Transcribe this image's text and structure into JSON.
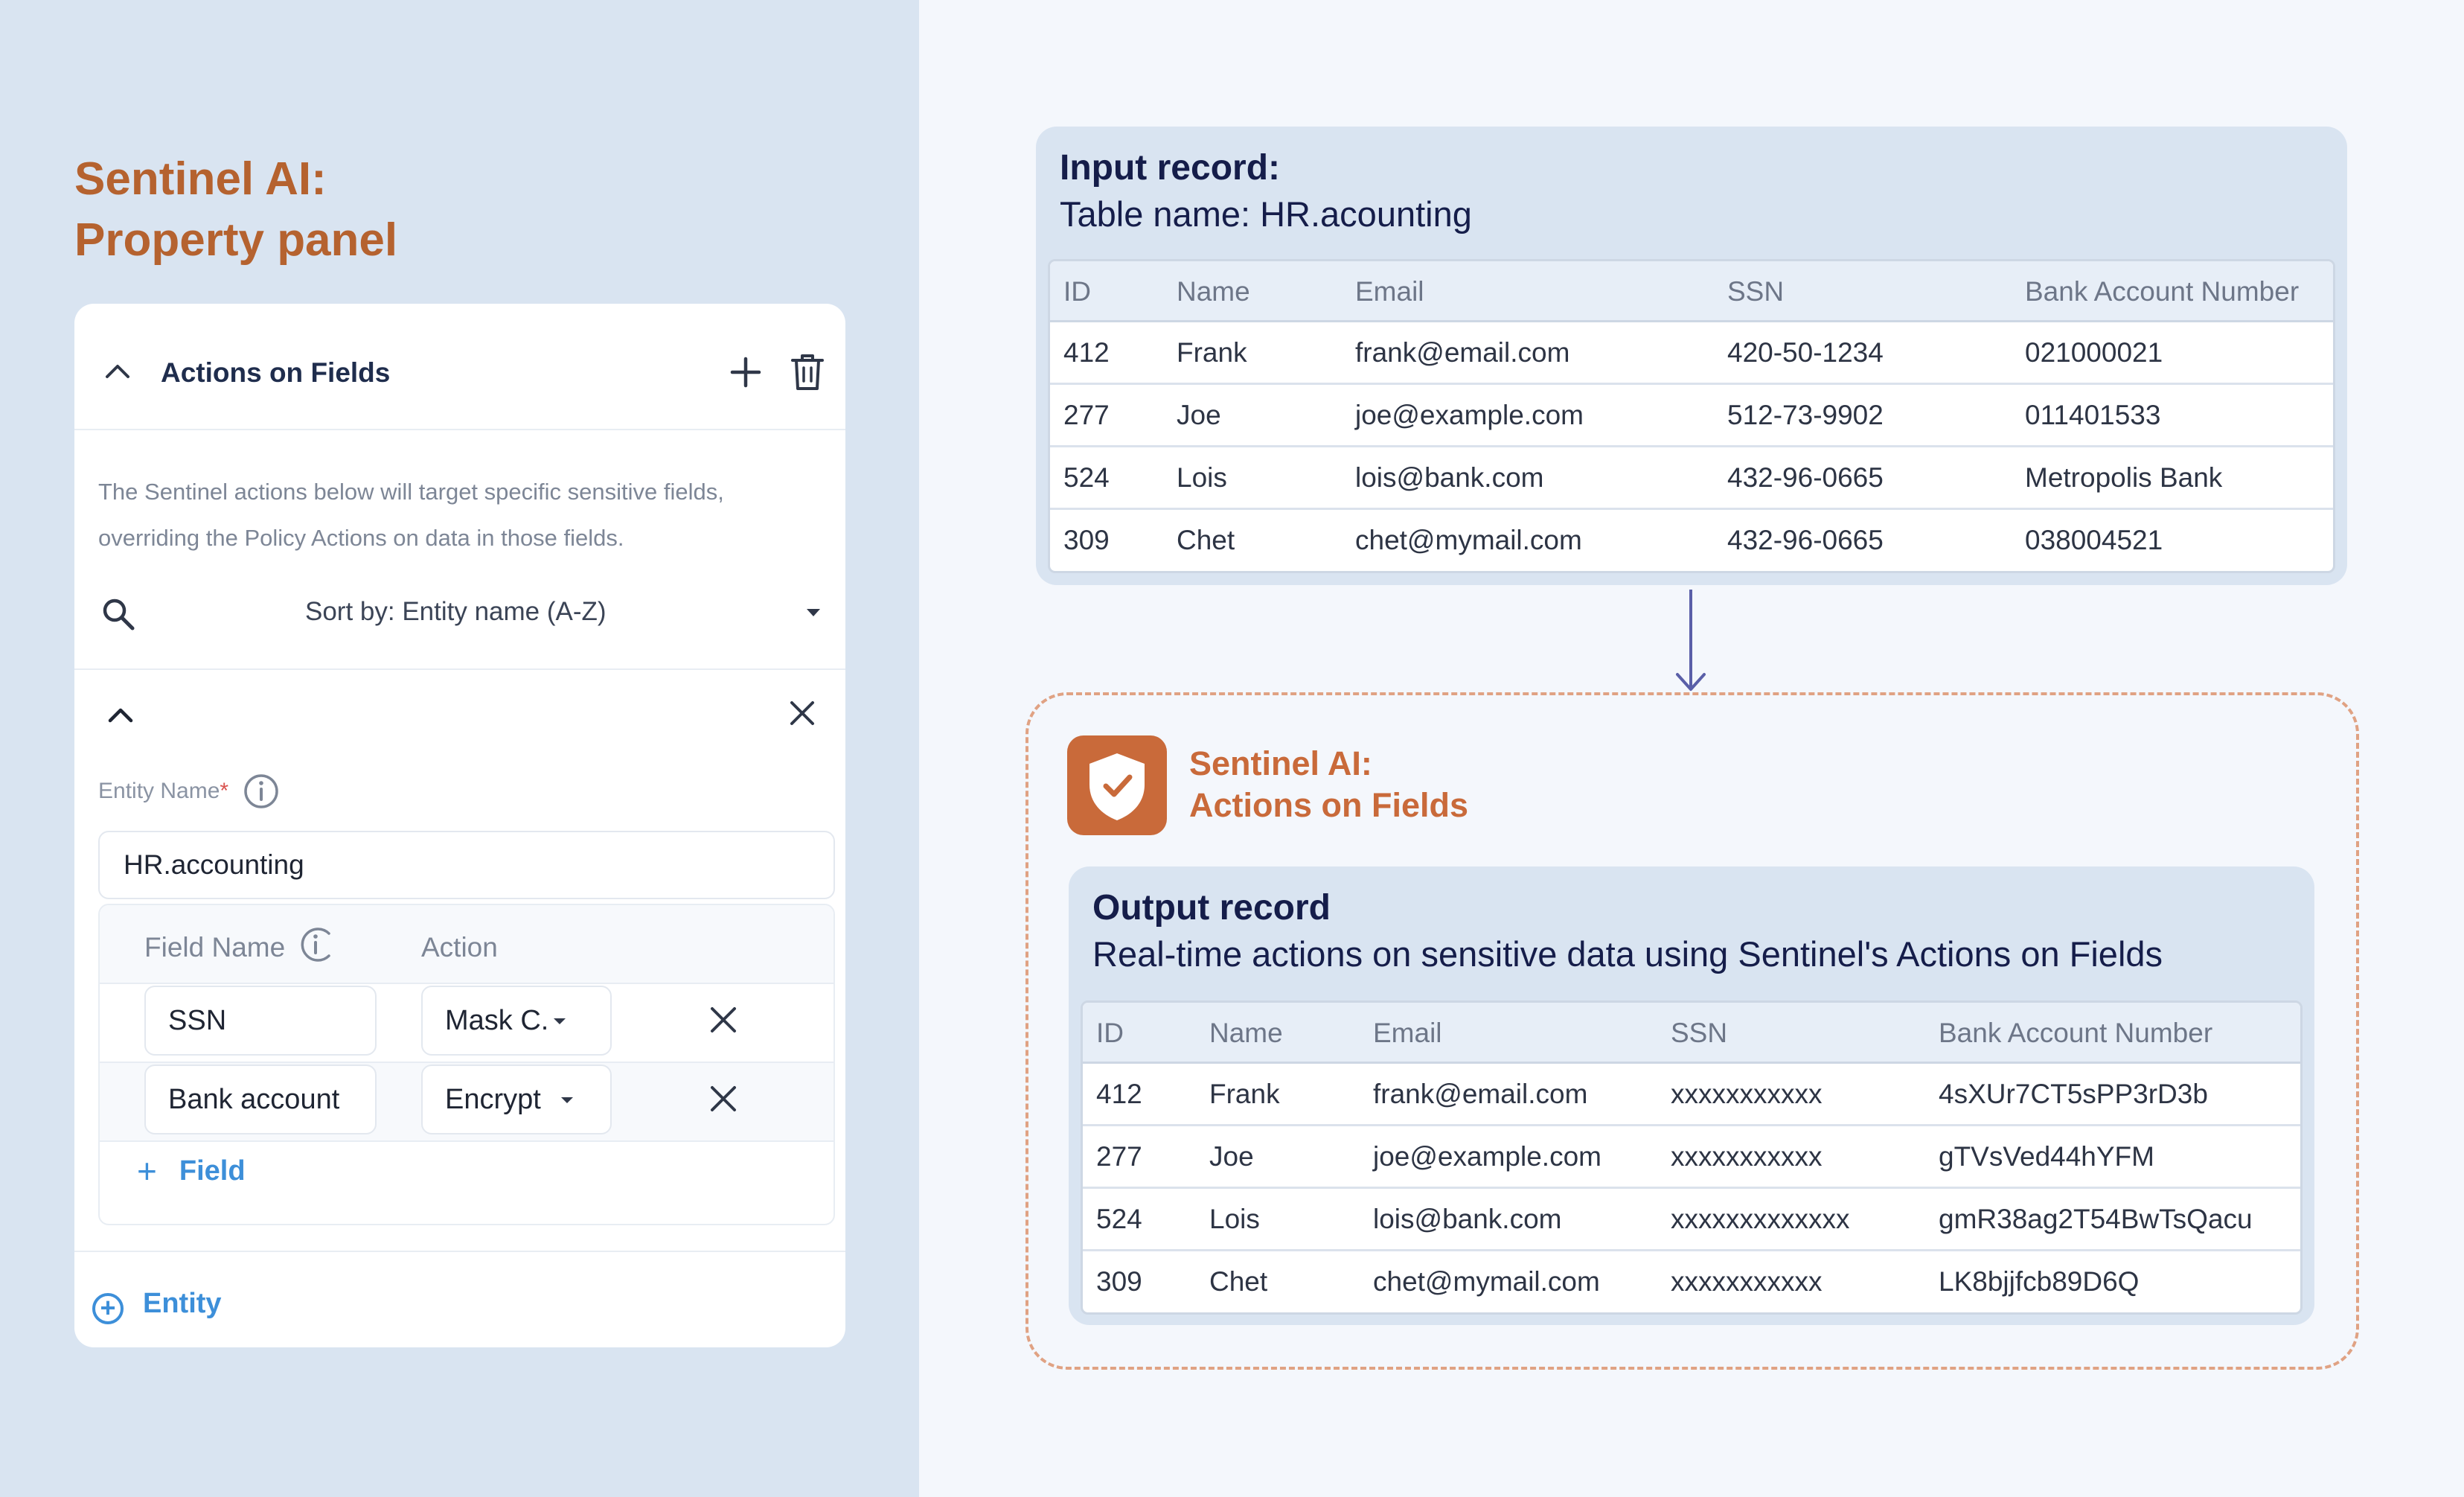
{
  "heading": {
    "line1": "Sentinel AI:",
    "line2": "Property panel"
  },
  "panel": {
    "title": "Actions on Fields",
    "description_line1": "The Sentinel actions below will target specific sensitive fields,",
    "description_line2": "overriding the Policy Actions on data in those fields.",
    "sort_label": "Sort by: Entity name (A-Z)",
    "entity_name_label": "Entity Name",
    "entity_required": "*",
    "entity_name_value": "HR.accounting",
    "field_name_header": "Field Name",
    "action_header": "Action",
    "fields": [
      {
        "name": "SSN",
        "action": "Mask C."
      },
      {
        "name": "Bank account",
        "action": "Encrypt"
      }
    ],
    "add_field_label": "Field",
    "add_entity_label": "Entity"
  },
  "input_record": {
    "title": "Input record:",
    "subtitle": "Table name: HR.acounting",
    "headers": [
      "ID",
      "Name",
      "Email",
      "SSN",
      "Bank Account Number"
    ],
    "rows": [
      [
        "412",
        "Frank",
        "frank@email.com",
        "420-50-1234",
        "021000021"
      ],
      [
        "277",
        "Joe",
        "joe@example.com",
        "512-73-9902",
        "011401533"
      ],
      [
        "524",
        "Lois",
        "lois@bank.com",
        "432-96-0665",
        "Metropolis Bank"
      ],
      [
        "309",
        "Chet",
        "chet@mymail.com",
        "432-96-0665",
        "038004521"
      ]
    ]
  },
  "sentinel_box": {
    "line1": "Sentinel AI:",
    "line2": "Actions on Fields"
  },
  "output_record": {
    "title": "Output record",
    "subtitle": "Real-time actions on sensitive data using Sentinel's Actions on Fields",
    "headers": [
      "ID",
      "Name",
      "Email",
      "SSN",
      "Bank Account Number"
    ],
    "rows": [
      [
        "412",
        "Frank",
        "frank@email.com",
        "xxxxxxxxxxx",
        "4sXUr7CT5sPP3rD3b"
      ],
      [
        "277",
        "Joe",
        "joe@example.com",
        "xxxxxxxxxxx",
        "gTVsVed44hYFM"
      ],
      [
        "524",
        "Lois",
        "lois@bank.com",
        "xxxxxxxxxxxxx",
        "gmR38ag2T54BwTsQacu"
      ],
      [
        "309",
        "Chet",
        "chet@mymail.com",
        "xxxxxxxxxxx",
        "LK8bjjfcb89D6Q"
      ]
    ]
  },
  "colors": {
    "left_background": "#d9e4f1",
    "right_background": "#f4f7fc",
    "heading": "#b5622f",
    "accent_blue": "#3d8fd9",
    "shield": "#c96a3a",
    "dashed_border": "#e0a283",
    "navy_text": "#151d4a"
  }
}
